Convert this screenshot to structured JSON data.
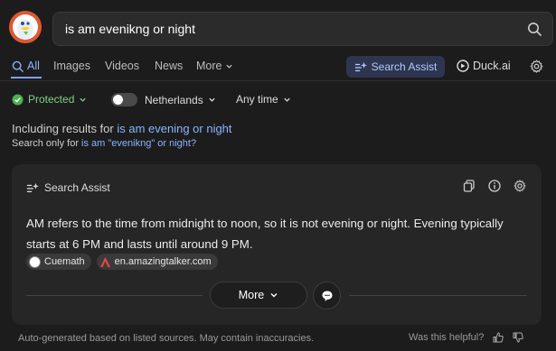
{
  "search": {
    "query": "is am evenikng or night"
  },
  "tabs": [
    {
      "label": "All"
    },
    {
      "label": "Images"
    },
    {
      "label": "Videos"
    },
    {
      "label": "News"
    },
    {
      "label": "More"
    }
  ],
  "header_actions": {
    "search_assist": "Search Assist",
    "duck_ai": "Duck.ai"
  },
  "filters": {
    "protected": "Protected",
    "region": "Netherlands",
    "time": "Any time"
  },
  "spelling": {
    "including_prefix": "Including results for ",
    "corrected_query": "is am evening or night",
    "search_only_prefix": "Search only for ",
    "original_query": "is am \"evenikng\" or night?"
  },
  "assist_card": {
    "title": "Search Assist",
    "answer": "AM refers to the time from midnight to noon, so it is not evening or night. Evening typically starts at 6 PM and lasts until around 9 PM.",
    "sources": [
      {
        "label": "Cuemath"
      },
      {
        "label": "en.amazingtalker.com"
      }
    ],
    "more_label": "More"
  },
  "footer": {
    "disclaimer": "Auto-generated based on listed sources. May contain inaccuracies.",
    "helpful": "Was this helpful?"
  },
  "colors": {
    "accent": "#8ab4ff",
    "protected": "#7fd086",
    "brand": "#de5833"
  }
}
